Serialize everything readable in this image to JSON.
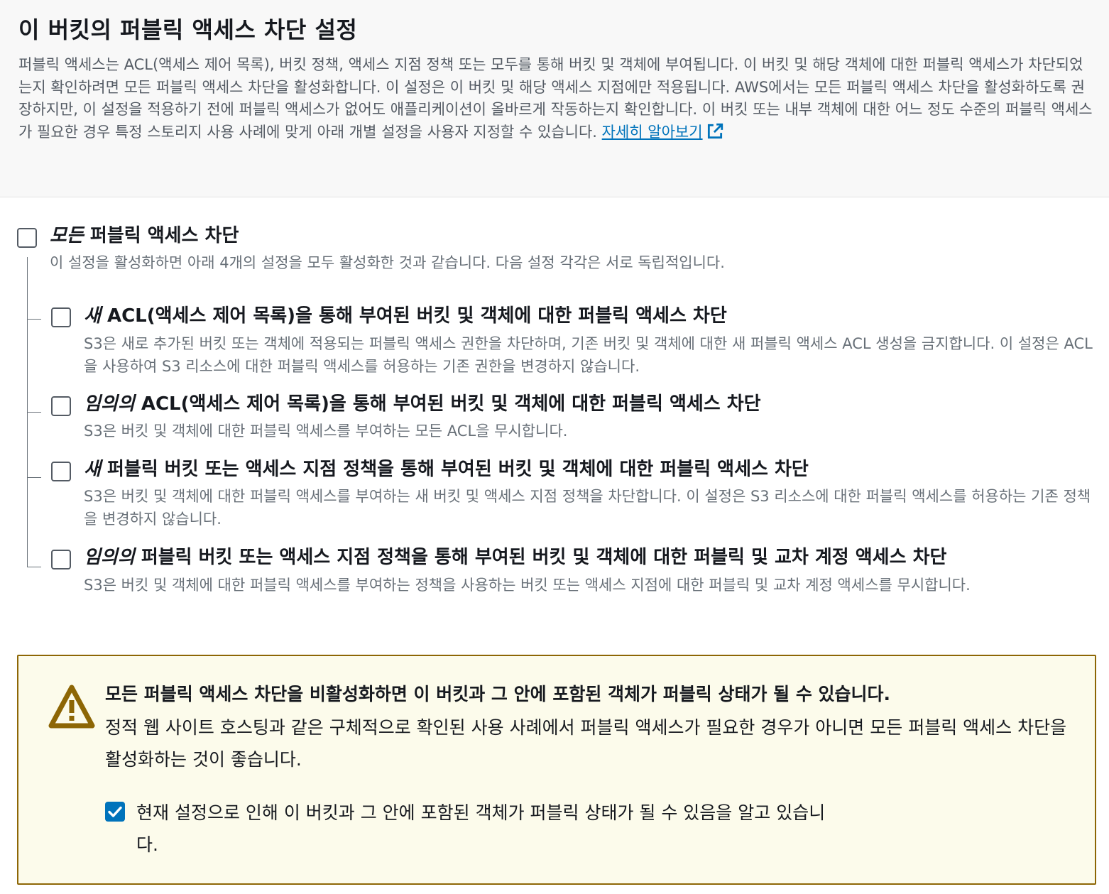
{
  "header": {
    "title": "이 버킷의 퍼블릭 액세스 차단 설정",
    "description": "퍼블릭 액세스는 ACL(액세스 제어 목록), 버킷 정책, 액세스 지점 정책 또는 모두를 통해 버킷 및 객체에 부여됩니다. 이 버킷 및 해당 객체에 대한 퍼블릭 액세스가 차단되었는지 확인하려면 모든 퍼블릭 액세스 차단을 활성화합니다. 이 설정은 이 버킷 및 해당 액세스 지점에만 적용됩니다. AWS에서는 모든 퍼블릭 액세스 차단을 활성화하도록 권장하지만, 이 설정을 적용하기 전에 퍼블릭 액세스가 없어도 애플리케이션이 올바르게 작동하는지 확인합니다. 이 버킷 또는 내부 객체에 대한 어느 정도 수준의 퍼블릭 액세스가 필요한 경우 특정 스토리지 사용 사례에 맞게 아래 개별 설정을 사용자 지정할 수 있습니다.",
    "learn_more": "자세히 알아보기"
  },
  "block_all": {
    "emphasis": "모든",
    "title": " 퍼블릭 액세스 차단",
    "description": "이 설정을 활성화하면 아래 4개의 설정을 모두 활성화한 것과 같습니다. 다음 설정 각각은 서로 독립적입니다.",
    "checked": false
  },
  "options": [
    {
      "emphasis": "새",
      "title": " ACL(액세스 제어 목록)을 통해 부여된 버킷 및 객체에 대한 퍼블릭 액세스 차단",
      "description": "S3은 새로 추가된 버킷 또는 객체에 적용되는 퍼블릭 액세스 권한을 차단하며, 기존 버킷 및 객체에 대한 새 퍼블릭 액세스 ACL 생성을 금지합니다. 이 설정은 ACL을 사용하여 S3 리소스에 대한 퍼블릭 액세스를 허용하는 기존 권한을 변경하지 않습니다.",
      "checked": false
    },
    {
      "emphasis": "임의의",
      "title": " ACL(액세스 제어 목록)을 통해 부여된 버킷 및 객체에 대한 퍼블릭 액세스 차단",
      "description": "S3은 버킷 및 객체에 대한 퍼블릭 액세스를 부여하는 모든 ACL을 무시합니다.",
      "checked": false
    },
    {
      "emphasis": "새",
      "title": " 퍼블릭 버킷 또는 액세스 지점 정책을 통해 부여된 버킷 및 객체에 대한 퍼블릭 액세스 차단",
      "description": "S3은 버킷 및 객체에 대한 퍼블릭 액세스를 부여하는 새 버킷 및 액세스 지점 정책을 차단합니다. 이 설정은 S3 리소스에 대한 퍼블릭 액세스를 허용하는 기존 정책을 변경하지 않습니다.",
      "checked": false
    },
    {
      "emphasis": "임의의",
      "title": " 퍼블릭 버킷 또는 액세스 지점 정책을 통해 부여된 버킷 및 객체에 대한 퍼블릭 및 교차 계정 액세스 차단",
      "description": "S3은 버킷 및 객체에 대한 퍼블릭 액세스를 부여하는 정책을 사용하는 버킷 또는 액세스 지점에 대한 퍼블릭 및 교차 계정 액세스를 무시합니다.",
      "checked": false
    }
  ],
  "warning": {
    "title": "모든 퍼블릭 액세스 차단을 비활성화하면 이 버킷과 그 안에 포함된 객체가 퍼블릭 상태가 될 수 있습니다.",
    "description": "정적 웹 사이트 호스팅과 같은 구체적으로 확인된 사용 사례에서 퍼블릭 액세스가 필요한 경우가 아니면 모든 퍼블릭 액세스 차단을 활성화하는 것이 좋습니다.",
    "acknowledge_label": "현재 설정으로 인해 이 버킷과 그 안에 포함된 객체가 퍼블릭 상태가 될 수 있음을 알고 있습니다.",
    "acknowledged": true
  },
  "colors": {
    "link": "#0073bb",
    "warning_border": "#8d6605",
    "warning_bg": "#fcfbeb",
    "warning_icon": "#8d6605",
    "checkbox_checked": "#0073bb"
  }
}
